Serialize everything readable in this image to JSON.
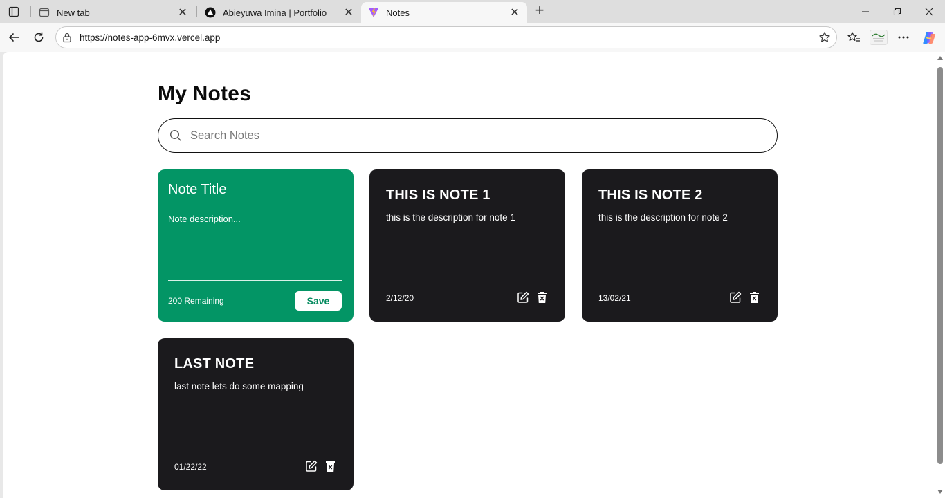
{
  "browser": {
    "tabs": [
      {
        "title": "New tab",
        "favicon": "new-tab-icon"
      },
      {
        "title": "Abieyuwa Imina | Portfolio",
        "favicon": "triangle-logo-icon"
      },
      {
        "title": "Notes",
        "favicon": "vite-logo-icon"
      }
    ],
    "active_tab": 2,
    "url": "https://notes-app-6mvx.vercel.app",
    "new_tab_symbol": "+"
  },
  "app": {
    "title": "My Notes",
    "search_placeholder": "Search Notes",
    "accent_color": "#039565",
    "card_color": "#1b1a1d",
    "new_note": {
      "title_placeholder": "Note Title",
      "description_placeholder": "Note description...",
      "remaining": "200 Remaining",
      "save_label": "Save"
    },
    "notes": [
      {
        "title": "THIS IS NOTE 1",
        "description": "this is the description for note 1",
        "date": "2/12/20"
      },
      {
        "title": "THIS IS NOTE 2",
        "description": "this is the description for note 2",
        "date": "13/02/21"
      },
      {
        "title": "LAST NOTE",
        "description": "last note lets do some mapping",
        "date": "01/22/22"
      }
    ]
  }
}
